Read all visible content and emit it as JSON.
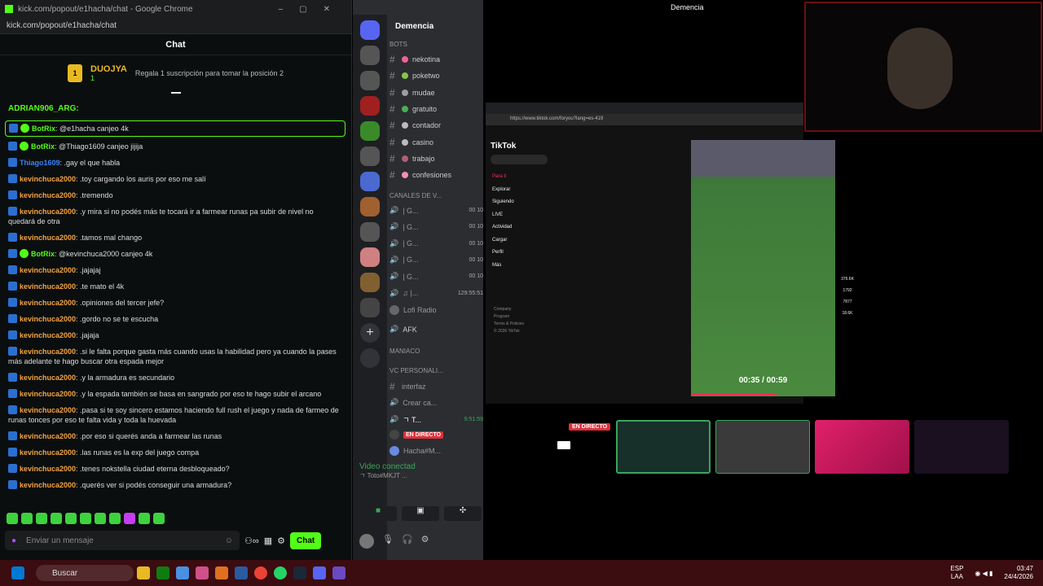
{
  "kick": {
    "window_title": "kick.com/popout/e1hacha/chat - Google Chrome",
    "url": "kick.com/popout/e1hacha/chat",
    "header": "Chat",
    "pinned": {
      "user": "DUOJYA",
      "count": "1",
      "gift_text": "Regala 1 suscripción para tomar la posición 2"
    },
    "top_user": "ADRIAN906_ARG:",
    "messages": [
      {
        "user": "BotRix",
        "text": ": @e1hacha canjeo 4k",
        "color": "#53fc18",
        "bot": true,
        "hl": true
      },
      {
        "user": "BotRix",
        "text": ": @Thiago1609 canjeo jijija",
        "color": "#53fc18",
        "bot": true
      },
      {
        "user": "Thiago1609",
        "text": ": .gay el que habla",
        "color": "#3b82f6"
      },
      {
        "user": "kevinchuca2000",
        "text": ": .toy cargando los auris por eso me salí",
        "color": "#f4a340"
      },
      {
        "user": "kevinchuca2000",
        "text": ": .tremendo",
        "color": "#f4a340"
      },
      {
        "user": "kevinchuca2000",
        "text": ": .y mira si no podés más te tocará ir a farmear runas pa subir de nivel no quedará de otra",
        "color": "#f4a340"
      },
      {
        "user": "kevinchuca2000",
        "text": ": .tamos mal chango",
        "color": "#f4a340"
      },
      {
        "user": "BotRix",
        "text": ": @kevinchuca2000 canjeo 4k",
        "color": "#53fc18",
        "bot": true
      },
      {
        "user": "kevinchuca2000",
        "text": ": .jajajaj",
        "color": "#f4a340"
      },
      {
        "user": "kevinchuca2000",
        "text": ": .te mato el 4k",
        "color": "#f4a340"
      },
      {
        "user": "kevinchuca2000",
        "text": ": .opiniones del tercer jefe?",
        "color": "#f4a340"
      },
      {
        "user": "kevinchuca2000",
        "text": ": .gordo no se te escucha",
        "color": "#f4a340"
      },
      {
        "user": "kevinchuca2000",
        "text": ": .jajaja",
        "color": "#f4a340"
      },
      {
        "user": "kevinchuca2000",
        "text": ": .si le falta porque gasta más cuando usas la habilidad pero ya cuando la pases más adelante te hago buscar otra espada mejor",
        "color": "#f4a340"
      },
      {
        "user": "kevinchuca2000",
        "text": ": .y la armadura es secundario",
        "color": "#f4a340"
      },
      {
        "user": "kevinchuca2000",
        "text": ": .y la espada también se basa en sangrado por eso te hago subir el arcano",
        "color": "#f4a340"
      },
      {
        "user": "kevinchuca2000",
        "text": ": .pasa si te soy sincero estamos haciendo full rush el juego y nada de farmeo de runas tonces por eso te falta vida y toda la huevada",
        "color": "#f4a340"
      },
      {
        "user": "kevinchuca2000",
        "text": ": .por eso si querés anda a farmear las runas",
        "color": "#f4a340"
      },
      {
        "user": "kevinchuca2000",
        "text": ": .las runas es la exp del juego compa",
        "color": "#f4a340"
      },
      {
        "user": "kevinchuca2000",
        "text": ": .tenes nokstella ciudad eterna desbloqueado?",
        "color": "#f4a340"
      },
      {
        "user": "kevinchuca2000",
        "text": ": .querés ver si podés conseguir una armadura?",
        "color": "#f4a340"
      }
    ],
    "input_placeholder": "Enviar un mensaje",
    "chat_button": "Chat"
  },
  "discord": {
    "server": "Demencia",
    "window_title": "Demencia",
    "channels": [
      {
        "cat": "BOTS"
      },
      {
        "name": "nekotina"
      },
      {
        "name": "poketwo"
      },
      {
        "name": "mudae"
      },
      {
        "name": "gratuito"
      },
      {
        "name": "contador"
      },
      {
        "name": "casino"
      },
      {
        "name": "trabajo"
      },
      {
        "name": "confesiones"
      }
    ],
    "voice_cat": "CANALES DE V...",
    "voice": [
      "| G...",
      "| G...",
      "| G...",
      "| G...",
      "| G...",
      "♫ |..."
    ],
    "voice_nums": [
      "00",
      "10"
    ],
    "timer": "129:55:51",
    "lofi": "Lofi Radio",
    "afk": "AFK",
    "maniaco": "MANIACO",
    "vc_personal": "VC PERSONALI...",
    "interfaz": "interfaz",
    "crear": "Crear ca...",
    "active": "ㄱ T...",
    "active_timer": "9:51:59",
    "live_badge": "EN DIRECTO",
    "hacha": "Hacha#M...",
    "video_status": "Video conectad",
    "video_sub": "ㄱ Toto#MKJT ..."
  },
  "tiktok": {
    "brand": "TikTok",
    "url": "https://www.tiktok.com/foryou?lang=es-419",
    "menu": [
      "Para ti",
      "Explorar",
      "Siguiendo",
      "LIVE",
      "Actividad",
      "Cargar",
      "Perfil",
      "Más"
    ],
    "footer": [
      "Company",
      "Program",
      "Terms & Policies",
      "© 2026 TikTok"
    ],
    "time": "00:35 / 00:59",
    "stats": [
      "376.6K",
      "1792",
      "7877",
      "18.6K"
    ]
  },
  "stream": {
    "live": "EN DIRECTO"
  },
  "taskbar": {
    "search": "Buscar",
    "lang": "ESP",
    "lang2": "LAA",
    "time": "03:47",
    "date": "24/4/2026"
  }
}
